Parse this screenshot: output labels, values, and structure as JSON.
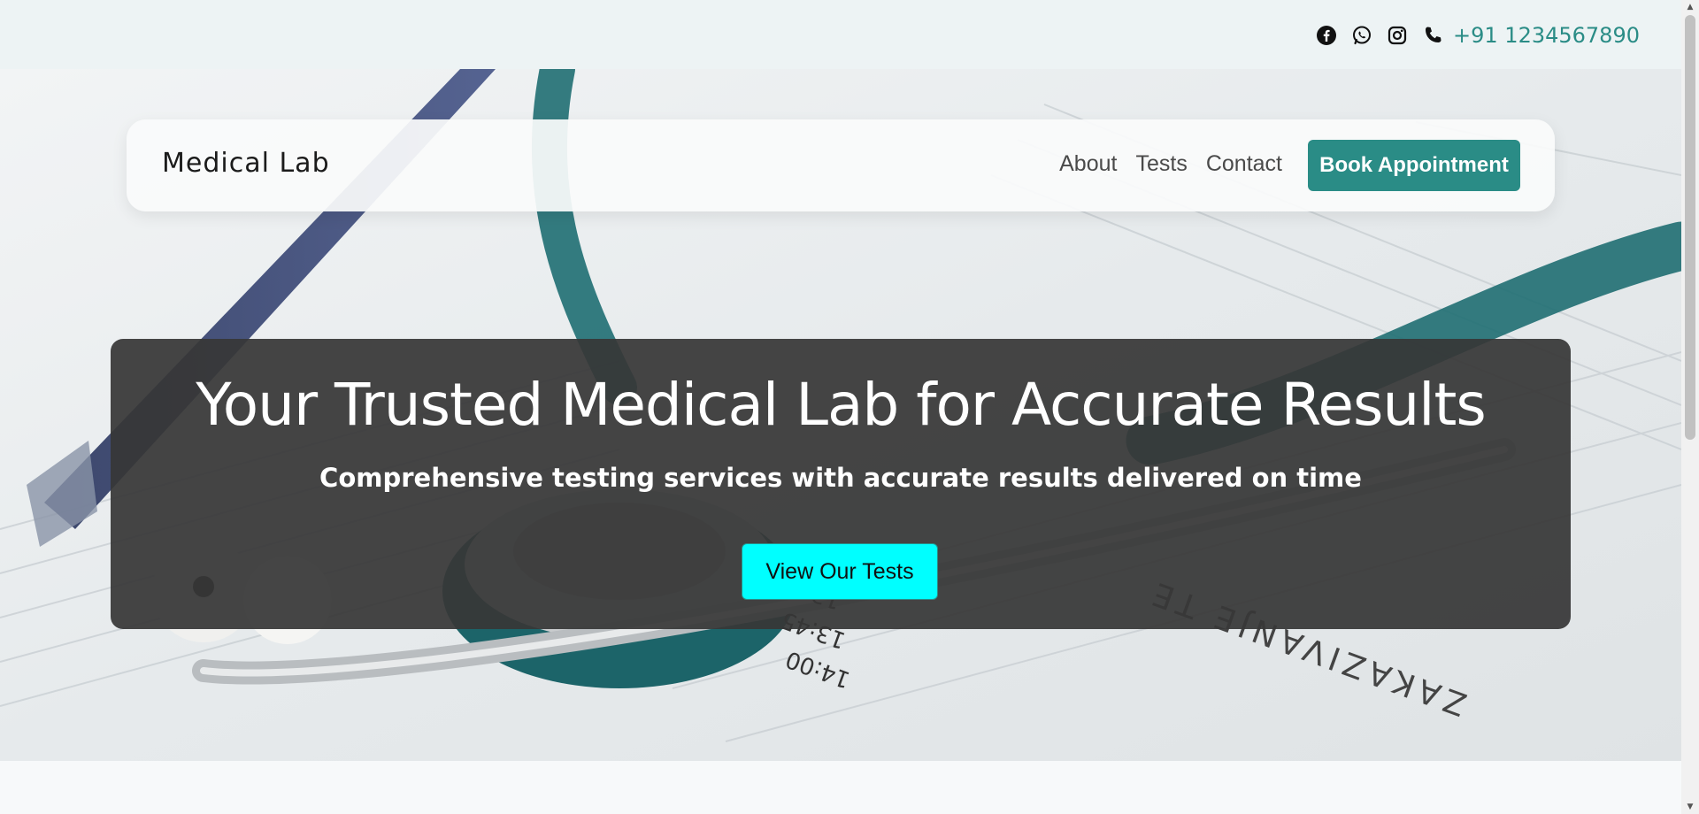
{
  "topbar": {
    "icons": [
      "facebook-icon",
      "whatsapp-icon",
      "instagram-icon",
      "phone-icon"
    ],
    "phone": "+91 1234567890",
    "accent_color": "#2a8c86"
  },
  "nav": {
    "brand": "Medical Lab",
    "links": [
      "About",
      "Tests",
      "Contact"
    ],
    "book_button": "Book Appointment"
  },
  "hero": {
    "title": "Your Trusted Medical Lab for Accurate Results",
    "subtitle": "Comprehensive testing services with accurate results delivered on time",
    "cta": "View Our Tests",
    "cta_color": "#00ffff"
  }
}
